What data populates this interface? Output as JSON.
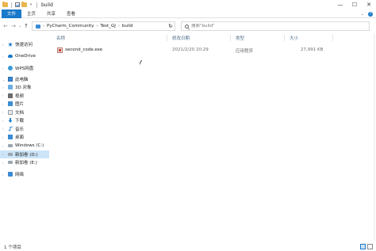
{
  "window": {
    "title": "build",
    "controls": {
      "minimize": "—",
      "maximize": "☐",
      "close": "✕"
    }
  },
  "ribbon": {
    "tabs": [
      "文件",
      "主页",
      "共享",
      "查看"
    ],
    "expand_icon": "chevron-down-icon",
    "help": "?"
  },
  "navigation": {
    "back": "←",
    "forward": "→",
    "recent": "⌄",
    "up": "↑",
    "refresh": "↻"
  },
  "address": {
    "breadcrumbs": [
      "PyCharm_Community",
      "Test_GJ",
      "build"
    ],
    "separator": "›",
    "dropdown": "⌄"
  },
  "search": {
    "placeholder": "搜索\"build\""
  },
  "sidebar": {
    "items": [
      {
        "label": "快速访问",
        "icon": "star-icon"
      },
      {
        "label": "OneDrive",
        "icon": "cloud-icon"
      },
      {
        "label": "WPS网盘",
        "icon": "wps-cloud-icon"
      },
      {
        "label": "此电脑",
        "icon": "computer-icon"
      },
      {
        "label": "3D 对象",
        "icon": "cube-icon"
      },
      {
        "label": "视频",
        "icon": "video-icon"
      },
      {
        "label": "图片",
        "icon": "picture-icon"
      },
      {
        "label": "文档",
        "icon": "document-icon"
      },
      {
        "label": "下载",
        "icon": "download-icon"
      },
      {
        "label": "音乐",
        "icon": "music-icon"
      },
      {
        "label": "桌面",
        "icon": "desktop-icon"
      },
      {
        "label": "Windows (C:)",
        "icon": "drive-icon"
      },
      {
        "label": "新加卷 (D:)",
        "icon": "drive-icon",
        "selected": true
      },
      {
        "label": "新加卷 (E:)",
        "icon": "drive-icon"
      },
      {
        "label": "网络",
        "icon": "network-icon"
      }
    ]
  },
  "columns": {
    "name": "名称",
    "date": "修改日期",
    "type": "类型",
    "size": "大小"
  },
  "files": [
    {
      "name": "second_code.exe",
      "date": "2021/2/20 20:29",
      "type": "应用程序",
      "size": "27,991 KB",
      "icon": "exe-file-icon"
    }
  ],
  "status": {
    "item_count": "1 个项目"
  },
  "colors": {
    "accent": "#1979ca",
    "selection": "#cce4f7"
  }
}
